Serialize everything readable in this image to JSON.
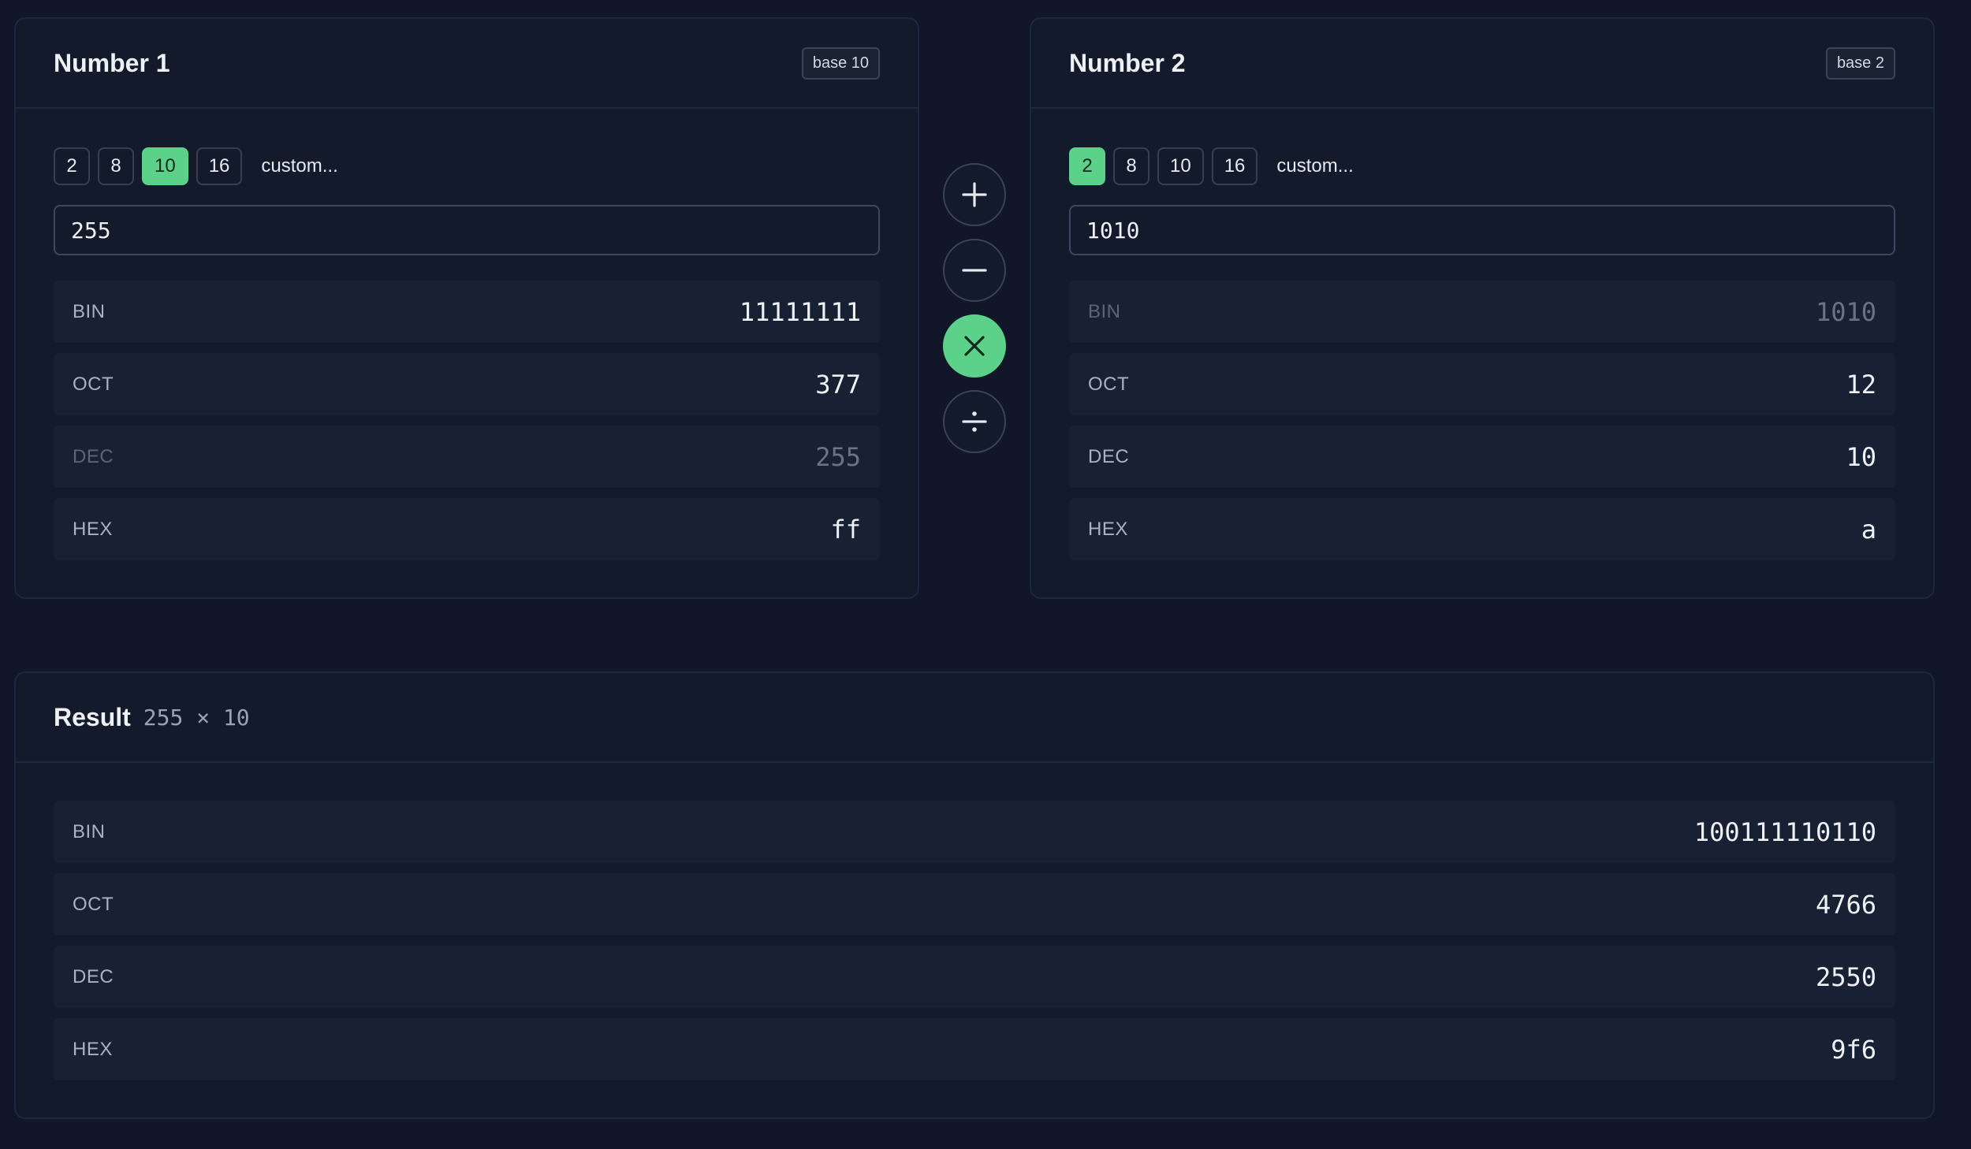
{
  "number1": {
    "title": "Number 1",
    "badge": "base 10",
    "bases": [
      "2",
      "8",
      "10",
      "16"
    ],
    "active_base": "10",
    "custom_label": "custom...",
    "input_value": "255",
    "rows": [
      {
        "label": "BIN",
        "value": "11111111"
      },
      {
        "label": "OCT",
        "value": "377"
      },
      {
        "label": "DEC",
        "value": "255"
      },
      {
        "label": "HEX",
        "value": "ff"
      }
    ]
  },
  "number2": {
    "title": "Number 2",
    "badge": "base 2",
    "bases": [
      "2",
      "8",
      "10",
      "16"
    ],
    "active_base": "2",
    "custom_label": "custom...",
    "input_value": "1010",
    "rows": [
      {
        "label": "BIN",
        "value": "1010"
      },
      {
        "label": "OCT",
        "value": "12"
      },
      {
        "label": "DEC",
        "value": "10"
      },
      {
        "label": "HEX",
        "value": "a"
      }
    ]
  },
  "operators": [
    {
      "name": "add",
      "icon": "plus-icon",
      "active": false
    },
    {
      "name": "subtract",
      "icon": "minus-icon",
      "active": false
    },
    {
      "name": "multiply",
      "icon": "times-icon",
      "active": true
    },
    {
      "name": "divide",
      "icon": "divide-icon",
      "active": false
    }
  ],
  "result": {
    "title": "Result",
    "expression": "255 × 10",
    "rows": [
      {
        "label": "BIN",
        "value": "100111110110"
      },
      {
        "label": "OCT",
        "value": "4766"
      },
      {
        "label": "DEC",
        "value": "2550"
      },
      {
        "label": "HEX",
        "value": "9f6"
      }
    ]
  },
  "colors": {
    "accent": "#5cd18a",
    "background": "#111628",
    "panel": "#121a2c"
  }
}
